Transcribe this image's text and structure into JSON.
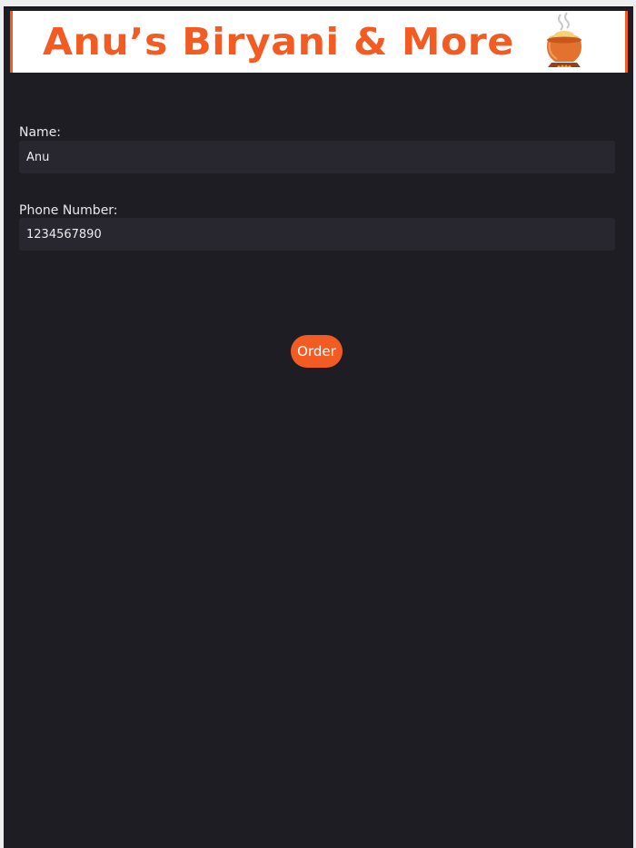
{
  "banner": {
    "title": "Anu’s Biryani & More",
    "icon": "clay-pot-icon"
  },
  "form": {
    "name_label": "Name:",
    "name_value": "Anu",
    "phone_label": "Phone Number:",
    "phone_value": "1234567890",
    "order_label": "Order"
  },
  "colors": {
    "accent": "#f25c22",
    "background": "#1e1d24",
    "input_bg": "#28272f",
    "text": "#e8e8ec"
  }
}
